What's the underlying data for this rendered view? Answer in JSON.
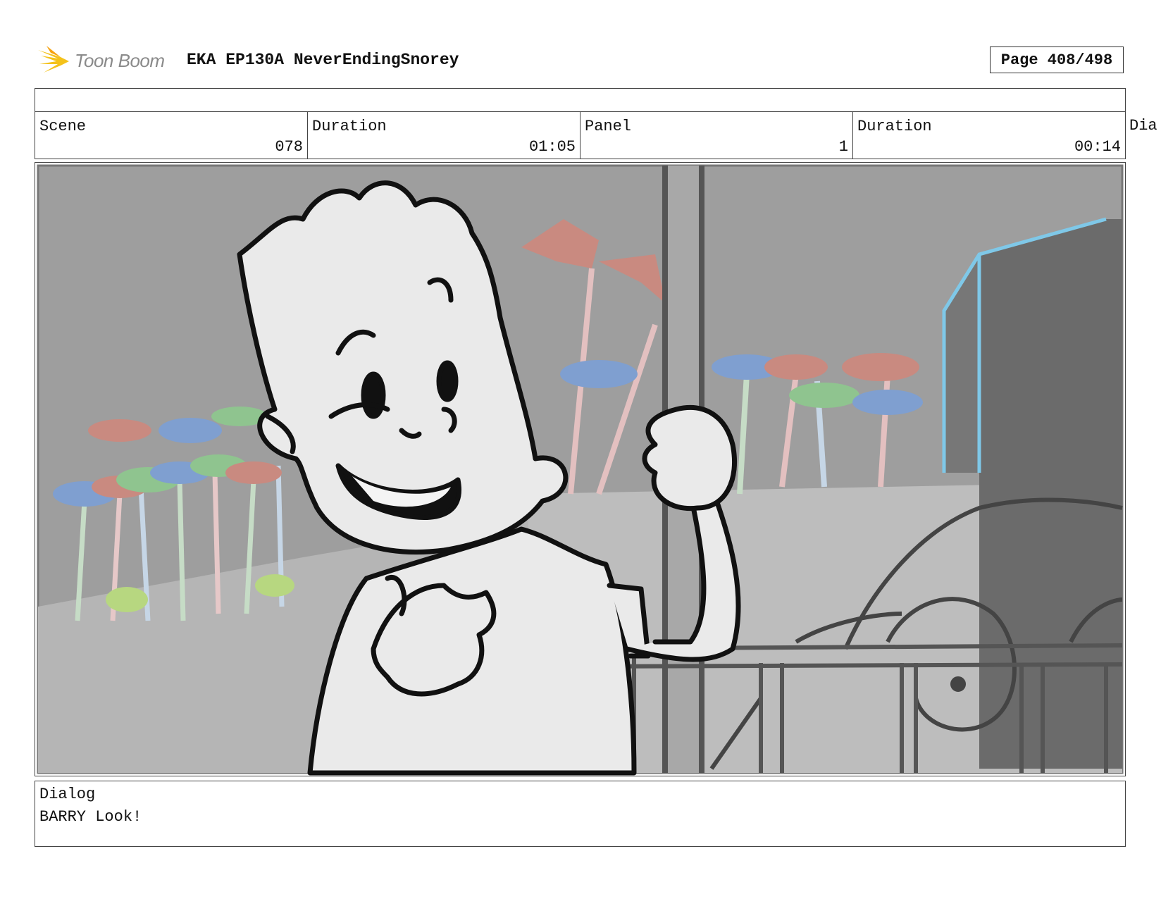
{
  "header": {
    "logo_text": "Toon Boom",
    "title": "EKA EP130A NeverEndingSnorey",
    "page": "Page 408/498"
  },
  "info": {
    "scene_label": "Scene",
    "scene_value": "078",
    "scene_duration_label": "Duration",
    "scene_duration_value": "01:05",
    "panel_label": "Panel",
    "panel_value": "1",
    "panel_duration_label": "Duration",
    "panel_duration_value": "00:14",
    "dialog_cut_label": "Dia"
  },
  "dialog": {
    "label": "Dialog",
    "text": "BARRY Look!"
  },
  "colors": {
    "sky": "#9e9e9e",
    "ground": "#b5b5b5",
    "character_fill": "#eaeaea",
    "line": "#111111",
    "accent_blue": "#7fc8e8"
  }
}
